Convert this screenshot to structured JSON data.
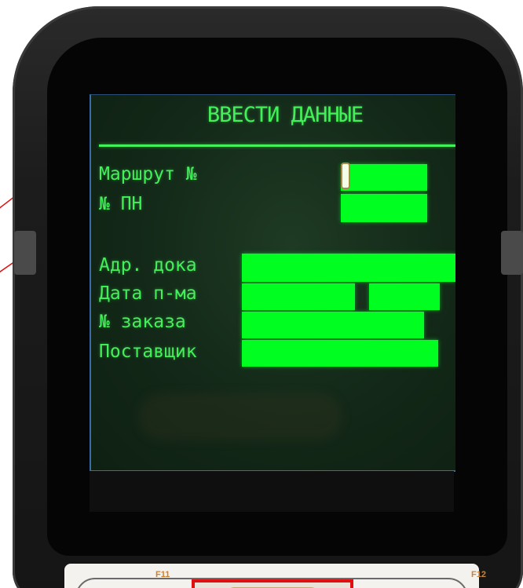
{
  "screen": {
    "title": "ВВЕСТИ ДАННЫЕ",
    "fields_top": [
      {
        "label": "Маршрут №",
        "value": ""
      },
      {
        "label": "№ ПН",
        "value": ""
      }
    ],
    "fields_bottom": [
      {
        "label": "Адр. дока",
        "value": ""
      },
      {
        "label": "Дата п-ма",
        "value": ""
      },
      {
        "label": "№ заказа",
        "value": ""
      },
      {
        "label": "Поставщик",
        "value": ""
      }
    ]
  },
  "keypad": {
    "left_key": "F11",
    "right_key": "F12"
  },
  "colors": {
    "text_green": "#44f05a",
    "field_green": "#00ff20",
    "highlight_red": "#e01010"
  }
}
